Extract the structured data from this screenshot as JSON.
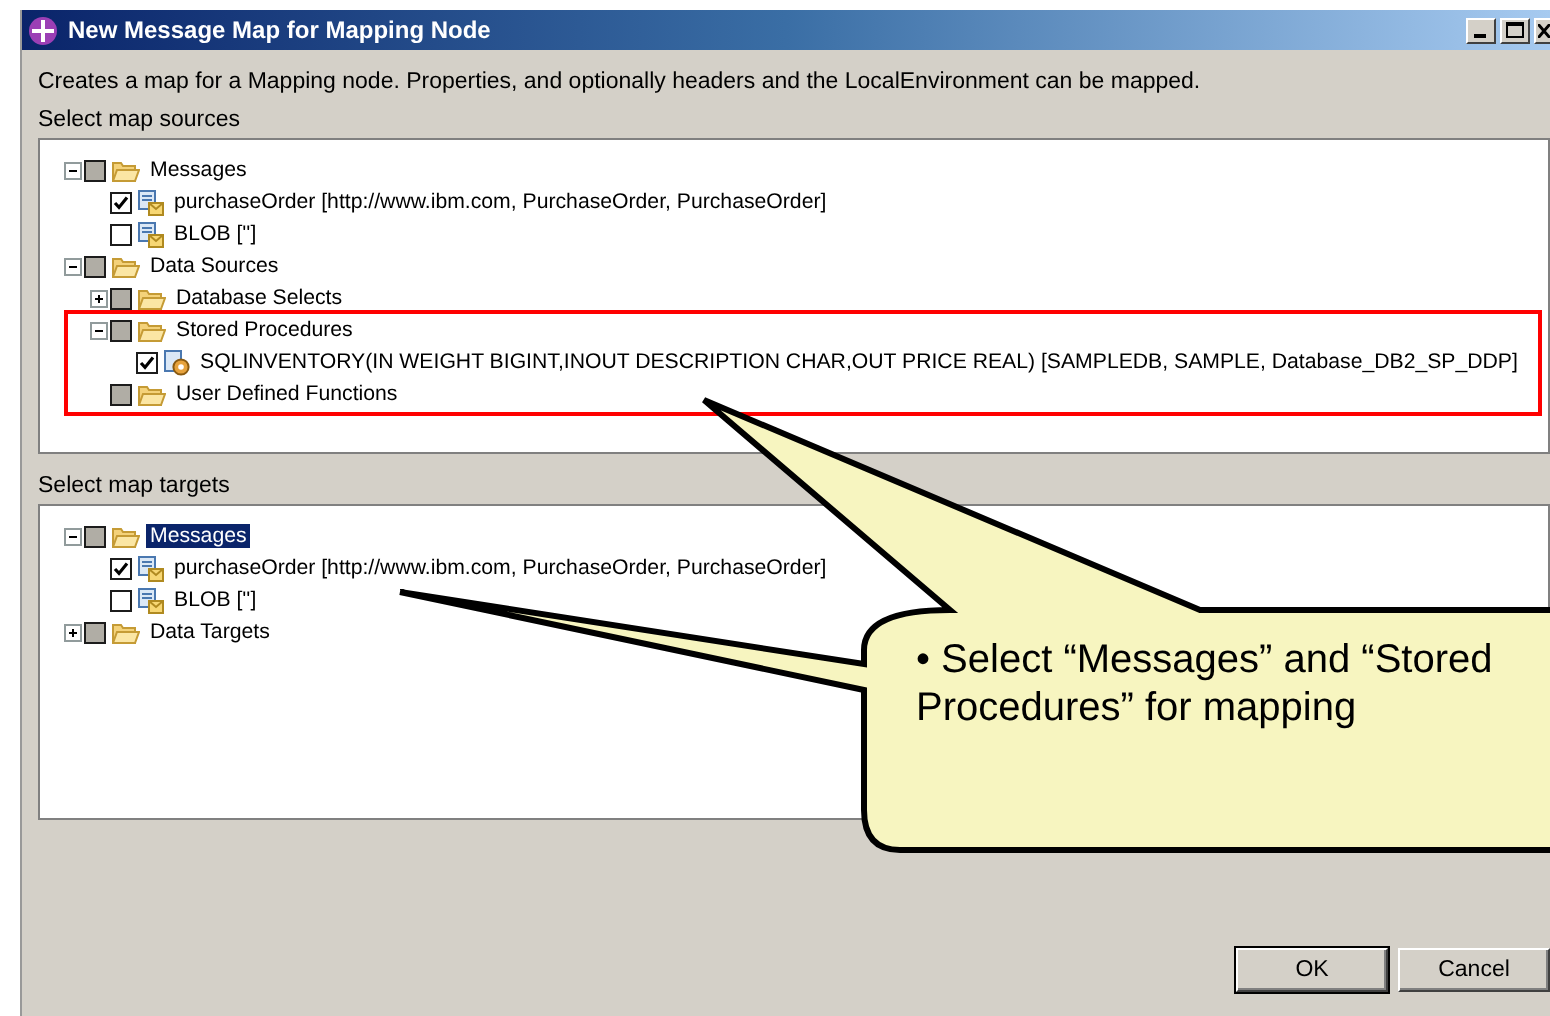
{
  "window": {
    "title": "New Message Map for Mapping Node"
  },
  "description": "Creates a map for a Mapping node. Properties, and optionally headers and the LocalEnvironment can be mapped.",
  "sources": {
    "label": "Select map sources",
    "items": [
      {
        "label": "Messages",
        "kind": "folder",
        "checked": false,
        "grayed": true,
        "selected": false,
        "expanded": true,
        "children": [
          {
            "label": "purchaseOrder [http://www.ibm.com, PurchaseOrder, PurchaseOrder]",
            "kind": "message",
            "checked": true,
            "grayed": false,
            "selected": false
          },
          {
            "label": "BLOB ['']",
            "kind": "message",
            "checked": false,
            "grayed": false,
            "selected": false
          }
        ]
      },
      {
        "label": "Data Sources",
        "kind": "folder",
        "checked": false,
        "grayed": true,
        "selected": false,
        "expanded": true,
        "children": [
          {
            "label": "Database Selects",
            "kind": "folder",
            "checked": false,
            "grayed": true,
            "selected": false,
            "expanded": false
          },
          {
            "label": "Stored Procedures",
            "kind": "folder",
            "checked": false,
            "grayed": true,
            "selected": false,
            "expanded": true,
            "children": [
              {
                "label": "SQLINVENTORY(IN WEIGHT BIGINT,INOUT DESCRIPTION CHAR,OUT PRICE REAL) [SAMPLEDB, SAMPLE, Database_DB2_SP_DDP]",
                "kind": "procedure",
                "checked": true,
                "grayed": false,
                "selected": false
              }
            ]
          },
          {
            "label": "User Defined Functions",
            "kind": "folder",
            "checked": false,
            "grayed": true,
            "selected": false
          }
        ]
      }
    ]
  },
  "targets": {
    "label": "Select map targets",
    "items": [
      {
        "label": "Messages",
        "kind": "folder",
        "checked": false,
        "grayed": true,
        "selected": true,
        "expanded": true,
        "children": [
          {
            "label": "purchaseOrder [http://www.ibm.com, PurchaseOrder, PurchaseOrder]",
            "kind": "message",
            "checked": true,
            "grayed": false,
            "selected": false
          },
          {
            "label": "BLOB ['']",
            "kind": "message",
            "checked": false,
            "grayed": false,
            "selected": false
          }
        ]
      },
      {
        "label": "Data Targets",
        "kind": "folder",
        "checked": false,
        "grayed": true,
        "selected": false,
        "expanded": false
      }
    ]
  },
  "callout": {
    "text": "• Select “Messages” and “Stored Procedures” for mapping"
  },
  "buttons": [
    "OK",
    "Cancel"
  ]
}
